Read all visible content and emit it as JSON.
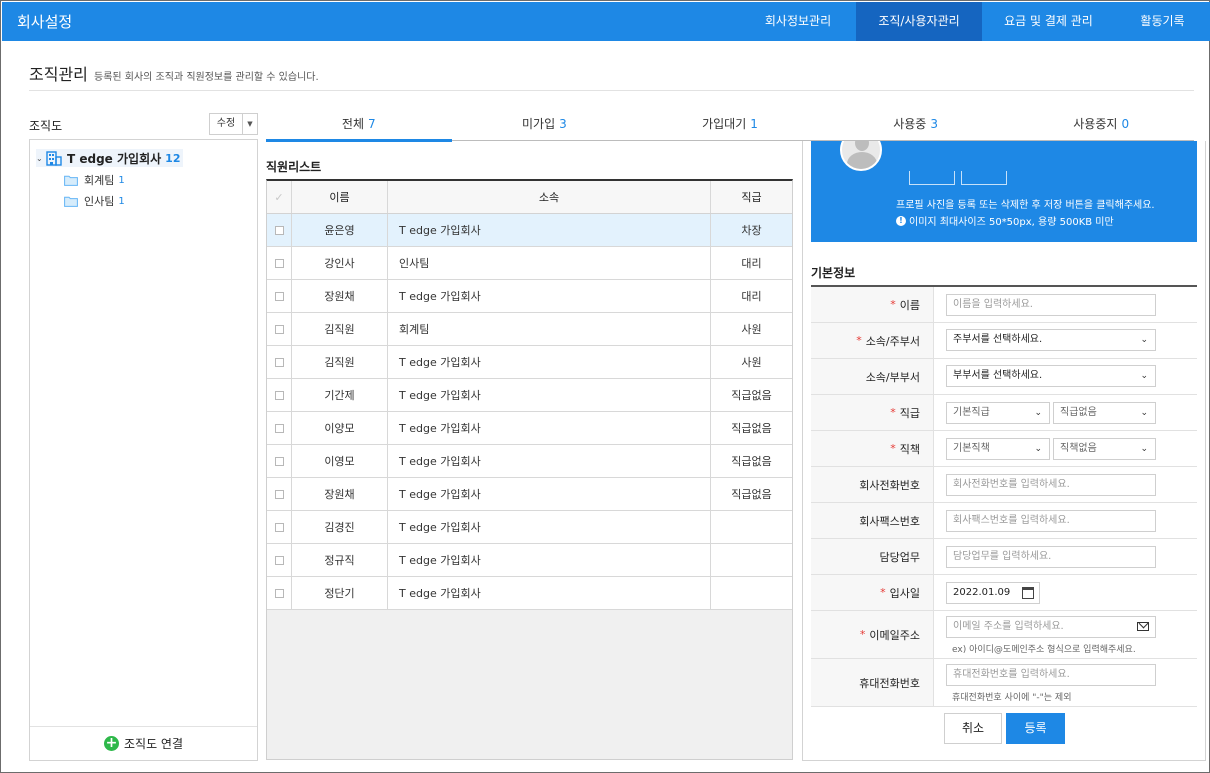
{
  "app": {
    "title": "회사설정"
  },
  "topnav": [
    {
      "label": "회사정보관리"
    },
    {
      "label": "조직/사용자관리"
    },
    {
      "label": "요금 및 결제 관리"
    },
    {
      "label": "활동기록"
    }
  ],
  "page": {
    "title": "조직관리",
    "desc": "등록된 회사의 조직과 직원정보를 관리할 수 있습니다."
  },
  "org": {
    "label": "조직도",
    "edit_label": "수정",
    "edit_arrow": "▼",
    "root": {
      "name": "T edge 가입회사",
      "count": "12"
    },
    "children": [
      {
        "name": "회계팀",
        "count": "1"
      },
      {
        "name": "인사팀",
        "count": "1"
      }
    ],
    "connect_label": "조직도 연결"
  },
  "tabs": [
    {
      "label": "전체",
      "count": "7"
    },
    {
      "label": "미가입",
      "count": "3"
    },
    {
      "label": "가입대기",
      "count": "1"
    },
    {
      "label": "사용중",
      "count": "3"
    },
    {
      "label": "사용중지",
      "count": "0"
    }
  ],
  "employees": {
    "title": "직원리스트",
    "headers": {
      "check": "✓",
      "name": "이름",
      "org": "소속",
      "rank": "직급"
    },
    "rows": [
      {
        "name": "윤은영",
        "org": "T edge 가입회사",
        "rank": "차장"
      },
      {
        "name": "강인사",
        "org": "인사팀",
        "rank": "대리"
      },
      {
        "name": "장원채",
        "org": "T edge 가입회사",
        "rank": "대리"
      },
      {
        "name": "김직원",
        "org": "회계팀",
        "rank": "사원"
      },
      {
        "name": "김직원",
        "org": "T edge 가입회사",
        "rank": "사원"
      },
      {
        "name": "기간제",
        "org": "T edge 가입회사",
        "rank": "직급없음"
      },
      {
        "name": "이양모",
        "org": "T edge 가입회사",
        "rank": "직급없음"
      },
      {
        "name": "이영모",
        "org": "T edge 가입회사",
        "rank": "직급없음"
      },
      {
        "name": "장원채",
        "org": "T edge 가입회사",
        "rank": "직급없음"
      },
      {
        "name": "김경진",
        "org": "T edge 가입회사",
        "rank": ""
      },
      {
        "name": "정규직",
        "org": "T edge 가입회사",
        "rank": ""
      },
      {
        "name": "정단기",
        "org": "T edge 가입회사",
        "rank": ""
      }
    ]
  },
  "photo": {
    "text": "프로필 사진을 등록 또는 삭제한 후 저장 버튼을 클릭해주세요.",
    "note": "이미지 최대사이즈 50*50px, 용량 500KB 미만",
    "info_glyph": "!"
  },
  "form": {
    "title": "기본정보",
    "required_mark": "*",
    "name": {
      "label": "이름",
      "placeholder": "이름을 입력하세요."
    },
    "main_dept": {
      "label": "소속/주부서",
      "value": "주부서를 선택하세요."
    },
    "sub_dept": {
      "label": "소속/부부서",
      "value": "부부서를 선택하세요."
    },
    "rank": {
      "label": "직급",
      "value1": "기본직급",
      "value2": "직급없음"
    },
    "duty": {
      "label": "직책",
      "value1": "기본직책",
      "value2": "직책없음"
    },
    "phone": {
      "label": "회사전화번호",
      "placeholder": "회사전화번호를 입력하세요."
    },
    "fax": {
      "label": "회사팩스번호",
      "placeholder": "회사팩스번호를 입력하세요."
    },
    "task": {
      "label": "담당업무",
      "placeholder": "담당업무를 입력하세요."
    },
    "join_date": {
      "label": "입사일",
      "value": "2022.01.09"
    },
    "email": {
      "label": "이메일주소",
      "placeholder": "이메일 주소를 입력하세요.",
      "hint": "ex) 아이디@도메인주소 형식으로 입력해주세요."
    },
    "mobile": {
      "label": "휴대전화번호",
      "placeholder": "휴대전화번호를 입력하세요.",
      "hint": "휴대전화번호 사이에 \"-\"는 제외"
    },
    "select_arrow": "⌄",
    "cancel_label": "취소",
    "submit_label": "등록"
  },
  "colors": {
    "accent": "#1e88e5",
    "accent_dark": "#1565c0",
    "required": "#e53935",
    "add": "#2eb84a",
    "selected_row": "#e3f2fd"
  }
}
